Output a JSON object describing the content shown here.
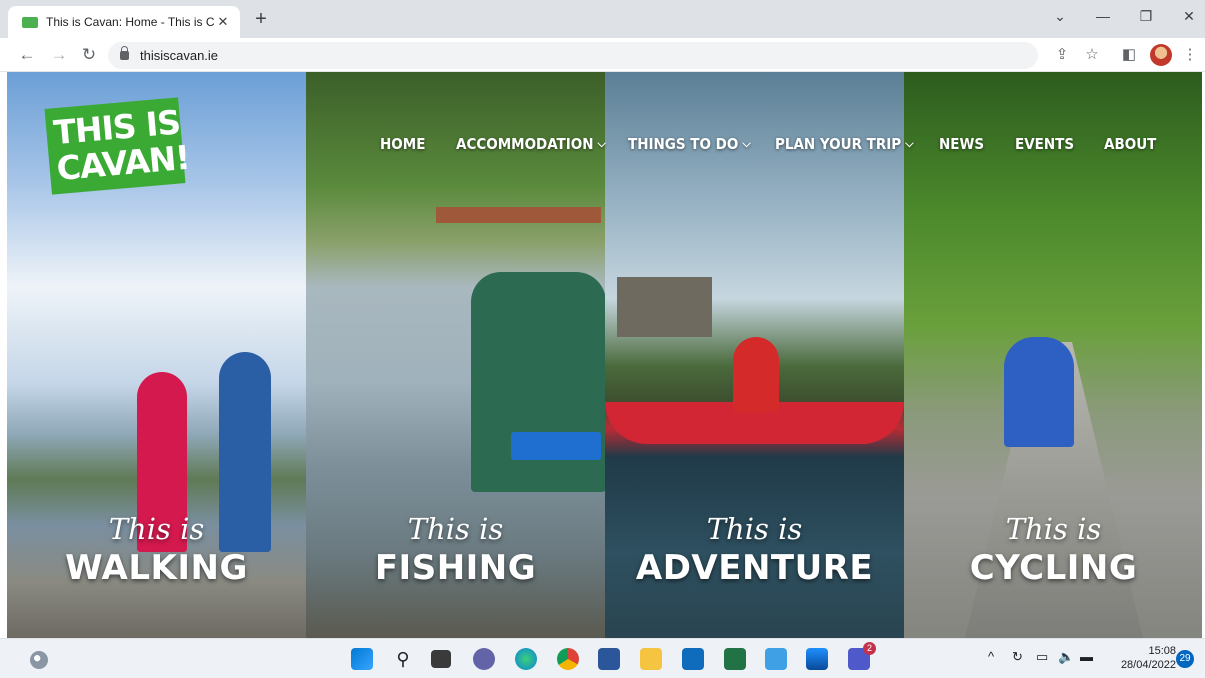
{
  "browser": {
    "tab_title": "This is Cavan: Home - This is Cav",
    "tab_close": "✕",
    "new_tab": "+",
    "url": "thisiscavan.ie",
    "minimize": "—",
    "maximize": "❐",
    "close": "✕"
  },
  "site": {
    "logo_line1": "THIS IS",
    "logo_line2": "CAVAN!",
    "nav": [
      {
        "label": "HOME"
      },
      {
        "label": "ACCOMMODATION"
      },
      {
        "label": "THINGS TO DO"
      },
      {
        "label": "PLAN YOUR TRIP"
      },
      {
        "label": "NEWS"
      },
      {
        "label": "EVENTS"
      },
      {
        "label": "ABOUT"
      }
    ],
    "panels": [
      {
        "script": "This is",
        "title": "WALKING"
      },
      {
        "script": "This is",
        "title": "FISHING"
      },
      {
        "script": "This is",
        "title": "ADVENTURE"
      },
      {
        "script": "This is",
        "title": "CYCLING"
      }
    ]
  },
  "taskbar": {
    "time": "15:08",
    "date": "28/04/2022",
    "notifications": "29",
    "teams_badge": "2"
  },
  "colors": {
    "logo_green": "#3aaa35",
    "kayak_red": "#d32634"
  }
}
